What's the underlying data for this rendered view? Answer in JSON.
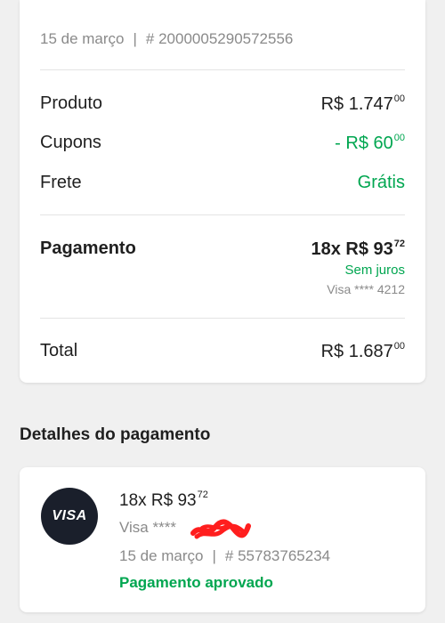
{
  "summary": {
    "date": "15 de março",
    "separator": "|",
    "order_number": "# 2000005290572556",
    "product": {
      "label": "Produto",
      "value": "R$ 1.747",
      "cents": "00"
    },
    "coupons": {
      "label": "Cupons",
      "value": "- R$ 60",
      "cents": "00"
    },
    "shipping": {
      "label": "Frete",
      "value": "Grátis"
    },
    "payment": {
      "label": "Pagamento",
      "value": "18x R$ 93",
      "cents": "72",
      "interest": "Sem juros",
      "card": "Visa **** 4212"
    },
    "total": {
      "label": "Total",
      "value": "R$ 1.687",
      "cents": "00"
    }
  },
  "details": {
    "title": "Detalhes do pagamento",
    "brand_logo": "VISA",
    "installments": "18x R$ 93",
    "installments_cents": "72",
    "card": "Visa ****",
    "date": "15 de março",
    "separator": "|",
    "operation_number": "# 55783765234",
    "status": "Pagamento aprovado"
  },
  "colors": {
    "accent_green": "#00a650",
    "visa_badge": "#1a1f2b",
    "redaction": "#ff1e1e"
  }
}
